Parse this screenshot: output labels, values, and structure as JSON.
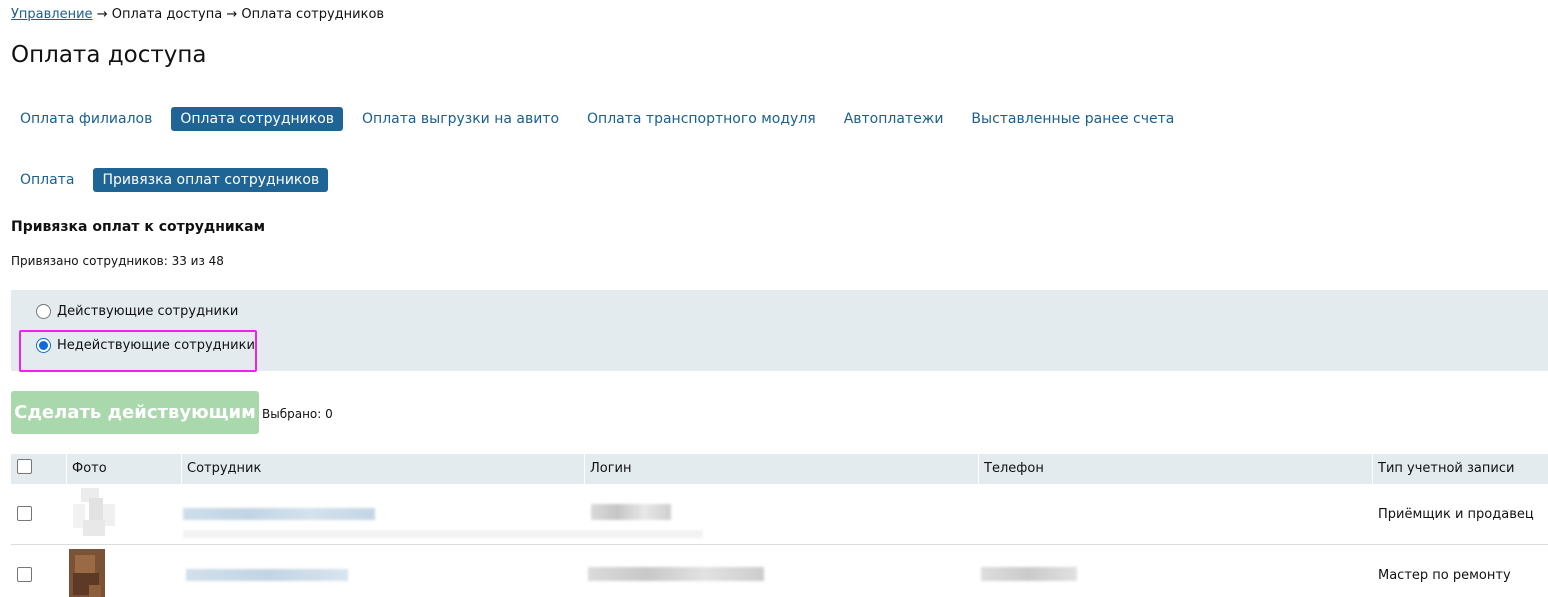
{
  "breadcrumb": {
    "root": "Управление",
    "rest": " → Оплата доступа → Оплата сотрудников"
  },
  "page_title": "Оплата доступа",
  "tabs": [
    {
      "label": "Оплата филиалов",
      "active": false
    },
    {
      "label": "Оплата сотрудников",
      "active": true
    },
    {
      "label": "Оплата выгрузки на авито",
      "active": false
    },
    {
      "label": "Оплата транспортного модуля",
      "active": false
    },
    {
      "label": "Автоплатежи",
      "active": false
    },
    {
      "label": "Выставленные ранее счета",
      "active": false
    }
  ],
  "subtabs": [
    {
      "label": "Оплата",
      "active": false
    },
    {
      "label": "Привязка оплат сотрудников",
      "active": true
    }
  ],
  "section_title": "Привязка оплат к сотрудникам",
  "bound_count": "Привязано сотрудников: 33 из 48",
  "filters": {
    "active_label": "Действующие сотрудники",
    "inactive_label": "Недействующие сотрудники",
    "selected": "inactive"
  },
  "make_active_button": "Сделать действующим",
  "selected_count": "Выбрано: 0",
  "table": {
    "columns": [
      "Фото",
      "Сотрудник",
      "Логин",
      "Телефон",
      "Тип учетной записи"
    ],
    "rows": [
      {
        "account_type": "Приёмщик и продавец"
      },
      {
        "account_type": "Мастер по ремонту"
      }
    ]
  },
  "colors": {
    "tab_active_bg": "#1e6494",
    "link": "#1a5f8f",
    "panel_bg": "#e3ebef",
    "button_disabled": "#a8d8ab",
    "highlight": "#ee22e8"
  }
}
